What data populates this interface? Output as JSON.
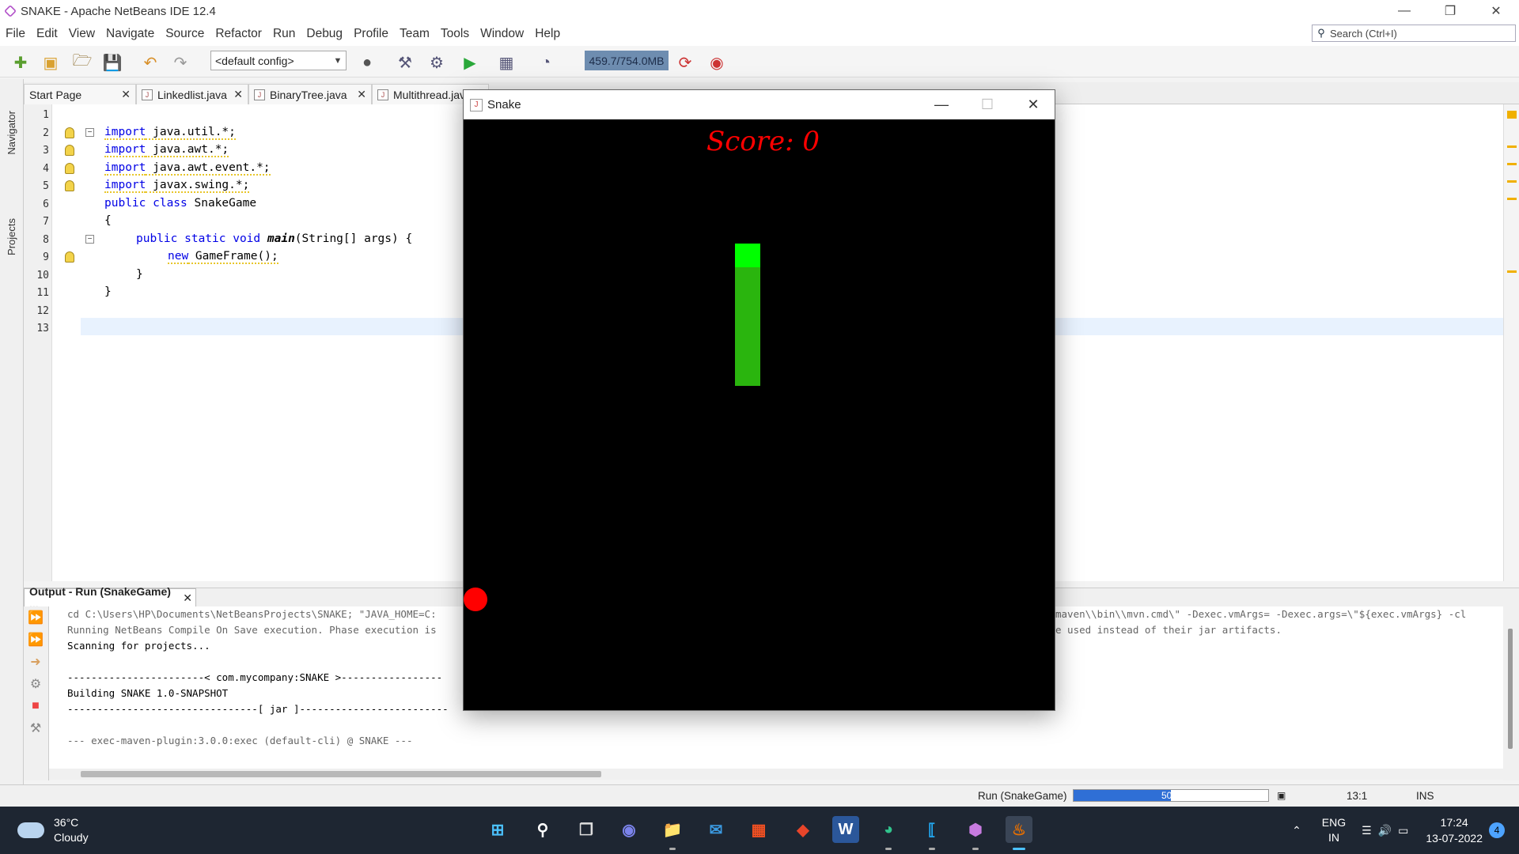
{
  "window": {
    "title": "SNAKE - Apache NetBeans IDE 12.4"
  },
  "menu": [
    "File",
    "Edit",
    "View",
    "Navigate",
    "Source",
    "Refactor",
    "Run",
    "Debug",
    "Profile",
    "Team",
    "Tools",
    "Window",
    "Help"
  ],
  "search": {
    "placeholder": "Search (Ctrl+I)"
  },
  "toolbar": {
    "config": "<default config>",
    "memory": "459.7/754.0MB"
  },
  "side_panels": {
    "navigator": "Navigator",
    "projects": "Projects"
  },
  "editor_tabs": [
    {
      "label": "Start Page"
    },
    {
      "label": "Linkedlist.java"
    },
    {
      "label": "BinaryTree.java"
    },
    {
      "label": "Multithread.java"
    }
  ],
  "code": {
    "line_numbers": [
      "1",
      "2",
      "3",
      "4",
      "5",
      "6",
      "7",
      "8",
      "9",
      "10",
      "11",
      "12",
      "13"
    ],
    "lines": {
      "l2_kw": "import",
      "l2": " java.util.*;",
      "l3_kw": "import",
      "l3": " java.awt.*;",
      "l4_kw": "import",
      "l4": " java.awt.event.*;",
      "l5_kw": "import",
      "l5": " javax.swing.*;",
      "l6_kw": "public class",
      "l6": " SnakeGame",
      "l7": "{",
      "l8_kw": "public static void",
      "l8_method": "main",
      "l8": "(String[] args) {",
      "l9_kw": "new",
      "l9": " GameFrame();",
      "l10": "}",
      "l11": "}"
    }
  },
  "output": {
    "tab_label": "Output - Run (SnakeGame) ...",
    "lines": [
      "cd C:\\Users\\HP\\Documents\\NetBeansProjects\\SNAKE; \"JAVA_HOME=C:",
      "Running NetBeans Compile On Save execution. Phase execution is",
      "Scanning for projects...",
      "",
      "-----------------------< com.mycompany:SNAKE >-----------------",
      "Building SNAKE 1.0-SNAPSHOT",
      "--------------------------------[ jar ]-------------------------",
      "",
      "--- exec-maven-plugin:3.0.0:exec (default-cli) @ SNAKE ---"
    ],
    "right_line_1": "maven\\\\bin\\\\mvn.cmd\\\" -Dexec.vmArgs= -Dexec.args=\\\"${exec.vmArgs} -cl",
    "right_line_2": "e used instead of their jar artifacts."
  },
  "status": {
    "task": "Run (SnakeGame)",
    "progress_percent": 50,
    "progress_label": "50%",
    "position": "13:1",
    "mode": "INS"
  },
  "snake_window": {
    "title": "Snake",
    "score_label": "Score: 0",
    "snake_color_head": "#00ff00",
    "snake_color_body": "#2ab50e",
    "apple_color": "#ff0000"
  },
  "taskbar": {
    "weather_temp": "36°C",
    "weather_desc": "Cloudy",
    "lang_1": "ENG",
    "lang_2": "IN",
    "time": "17:24",
    "date": "13-07-2022",
    "notifications": "4"
  }
}
